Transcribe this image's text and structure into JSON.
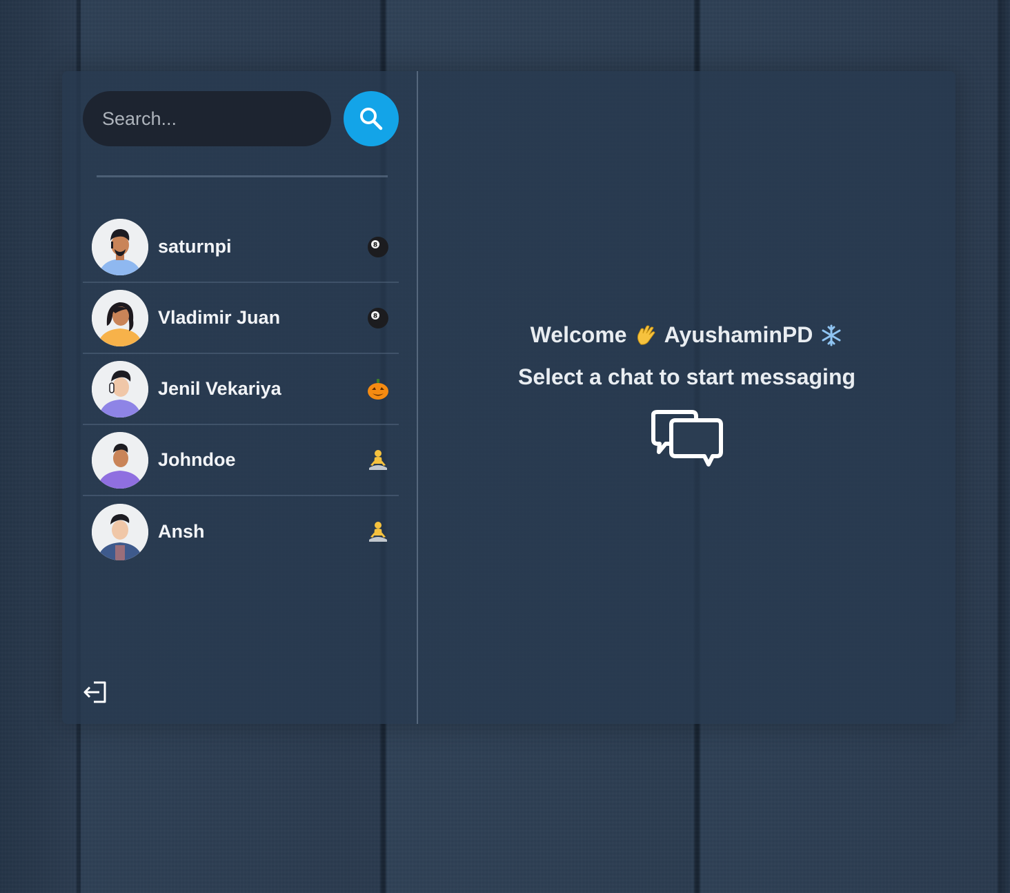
{
  "search": {
    "placeholder": "Search..."
  },
  "conversations": [
    {
      "name": "saturnpi",
      "emoji": "billiard-8-ball-icon"
    },
    {
      "name": "Vladimir Juan",
      "emoji": "billiard-8-ball-icon"
    },
    {
      "name": "Jenil Vekariya",
      "emoji": "jack-o-lantern-icon"
    },
    {
      "name": "Johndoe",
      "emoji": "meditating-person-icon"
    },
    {
      "name": "Ansh",
      "emoji": "meditating-person-icon"
    }
  ],
  "main": {
    "welcome_prefix": "Welcome",
    "username": "AyushaminPD",
    "select_text": "Select a chat to start messaging"
  },
  "colors": {
    "accent": "#13a4e8",
    "panel": "#283a50",
    "text": "#f2f4f7"
  }
}
